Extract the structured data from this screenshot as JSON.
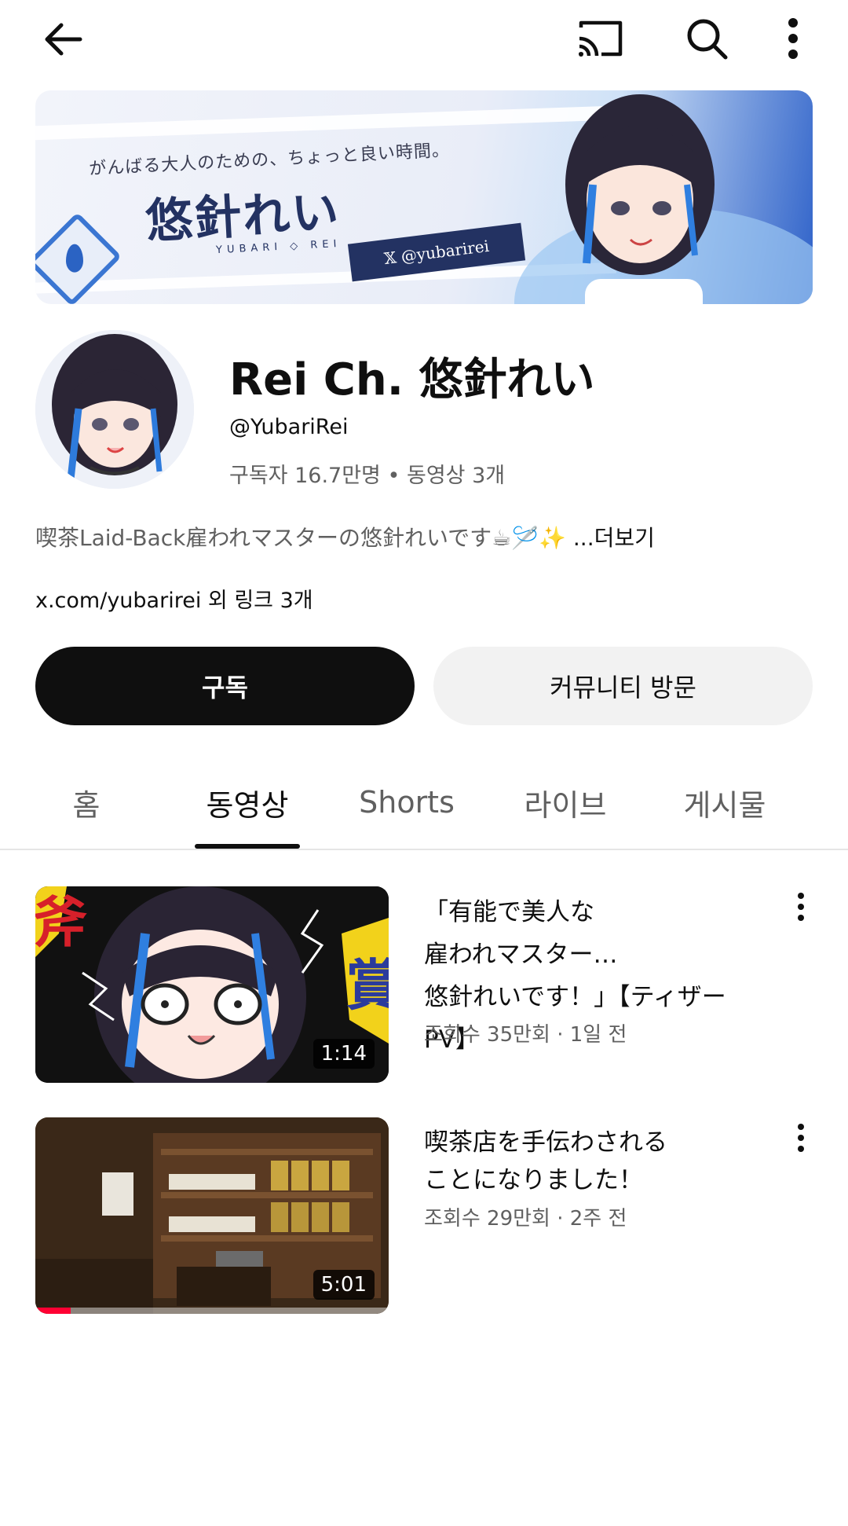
{
  "topbar": {
    "back_icon": "arrow-left-icon",
    "cast_icon": "cast-icon",
    "search_icon": "search-icon",
    "more_icon": "more-vert-icon"
  },
  "banner": {
    "tagline": "がんばる大人のための、ちょっと良い時間。",
    "logo": "悠針れい",
    "logo_sub": "YUBARI ◇ REI",
    "twitter_handle": "𝕏 @yubarirei"
  },
  "channel": {
    "name": "Rei Ch. 悠針れい",
    "handle": "@YubariRei",
    "stats": "구독자 16.7만명 • 동영상 3개",
    "description": "喫茶Laid-Back雇われマスターの悠針れいです☕🪡✨ ",
    "description_more": "...더보기",
    "links": "x.com/yubarirei 외 링크 3개"
  },
  "actions": {
    "subscribe": "구독",
    "community": "커뮤니티 방문"
  },
  "tabs": [
    {
      "label": "홈"
    },
    {
      "label": "동영상"
    },
    {
      "label": "Shorts"
    },
    {
      "label": "라이브"
    },
    {
      "label": "게시물"
    }
  ],
  "active_tab": "동영상",
  "videos": [
    {
      "title_lines": [
        "「有能で美人な",
        "雇われマスター…",
        "悠針れいです！」【ティザーPV】"
      ],
      "meta": "조회수 35만회 · 1일 전",
      "duration": "1:14",
      "progress": 0
    },
    {
      "title_lines": [
        "喫茶店を手伝わされる",
        "ことになりました！"
      ],
      "meta": "조회수 29만회 · 2주 전",
      "duration": "5:01",
      "progress": 0.1
    }
  ]
}
